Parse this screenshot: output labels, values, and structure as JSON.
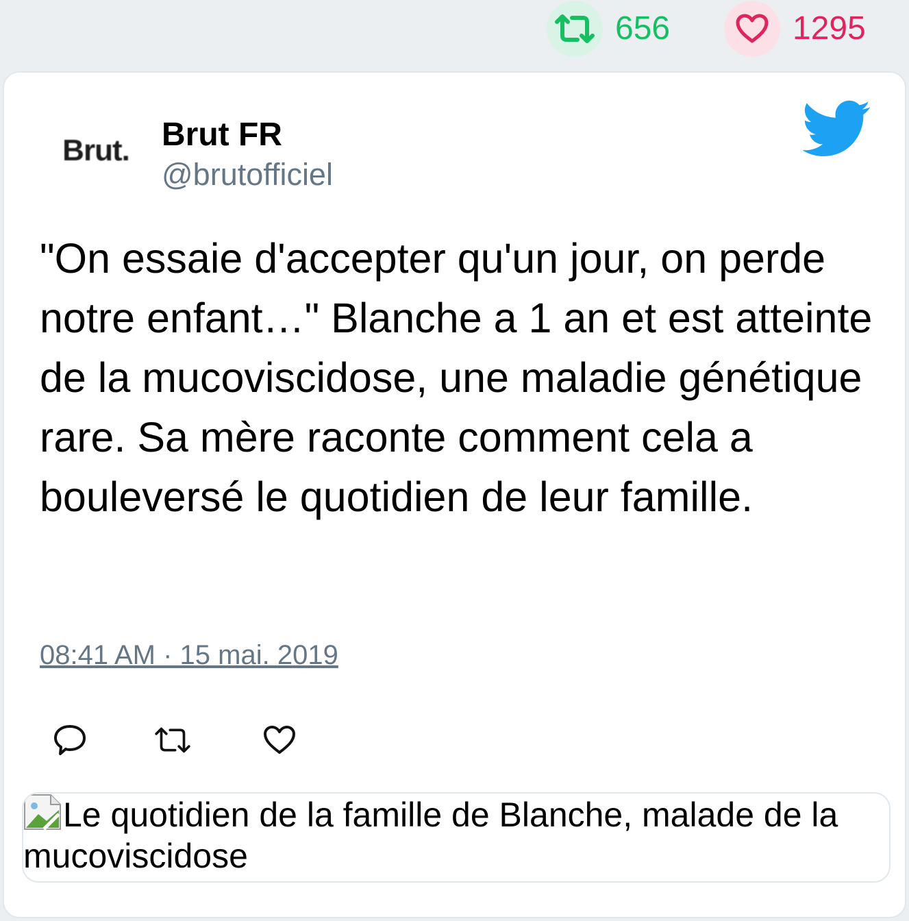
{
  "stats": {
    "retweets": "656",
    "likes": "1295",
    "retweet_color": "#17bf63",
    "like_color": "#e0245e"
  },
  "tweet": {
    "avatar_text": "Brut.",
    "display_name": "Brut FR",
    "handle": "@brutofficiel",
    "text": "\"On essaie d'accepter qu'un jour, on perde notre enfant…\" Blanche a 1 an et est atteinte de la mucoviscidose, une maladie génétique rare. Sa mère raconte comment cela a bouleversé le quotidien de leur famille.",
    "timestamp": "08:41 AM · 15 mai. 2019",
    "media_alt": "Le quotidien de la famille de Blanche, malade de la mucoviscidose",
    "brand_icon": "twitter-bird-icon",
    "brand_color": "#1da1f2"
  },
  "actions": {
    "icons": [
      "reply-icon",
      "retweet-icon",
      "like-icon"
    ]
  }
}
